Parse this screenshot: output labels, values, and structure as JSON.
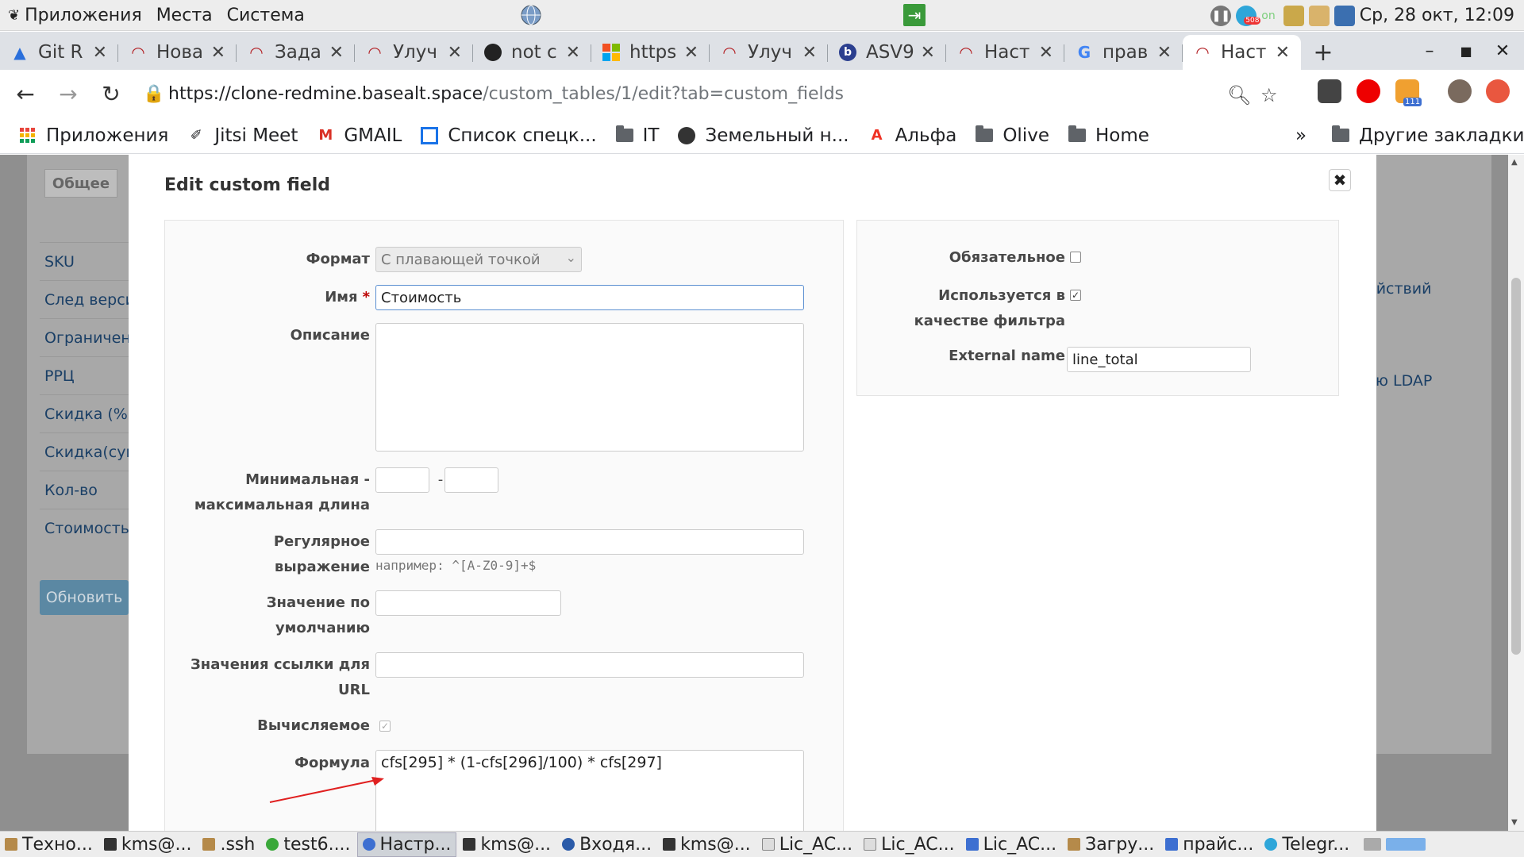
{
  "system_panel": {
    "menu": [
      "Приложения",
      "Места",
      "Система"
    ],
    "clock": "Ср, 28 окт, 12:09",
    "telegram_badge": "508",
    "status_on": "on"
  },
  "tabs": [
    {
      "title": "Git R",
      "icon": "atlassian-icon"
    },
    {
      "title": "Нова",
      "icon": "redmine-icon"
    },
    {
      "title": "Зада",
      "icon": "redmine-icon"
    },
    {
      "title": "Улуч",
      "icon": "redmine-icon"
    },
    {
      "title": "not c",
      "icon": "github-icon"
    },
    {
      "title": "https",
      "icon": "microsoft-icon"
    },
    {
      "title": "Улуч",
      "icon": "redmine-icon"
    },
    {
      "title": "ASV9",
      "icon": "b-icon"
    },
    {
      "title": "Наст",
      "icon": "redmine-icon"
    },
    {
      "title": "прав",
      "icon": "google-icon"
    },
    {
      "title": "Наст",
      "icon": "redmine-icon"
    }
  ],
  "address": {
    "host": "https://clone-redmine.basealt.space",
    "path": "/custom_tables/1/edit?tab=custom_fields",
    "rss_badge": "111"
  },
  "bookmarks": {
    "items": [
      "Приложения",
      "Jitsi Meet",
      "GMAIL",
      "Список спецк...",
      "IT",
      "Земельный н...",
      "Альфа",
      "Olive",
      "Home"
    ],
    "more": "»",
    "other": "Другие закладки"
  },
  "background": {
    "tab": "Общее",
    "list": [
      "SKU",
      "След верси",
      "Ограничени",
      "РРЦ",
      "Скидка (%)",
      "Скидка(сум",
      "Кол-во",
      "Стоимость"
    ],
    "update_button": "Обновить",
    "right_1": "ействий",
    "right_2": "ю LDAP"
  },
  "modal": {
    "title": "Edit custom field",
    "close": "✖",
    "labels": {
      "format": "Формат",
      "name": "Имя",
      "required_mark": "*",
      "description": "Описание",
      "minmax_1": "Минимальная -",
      "minmax_2": "максимальная длина",
      "minmax_sep": "-",
      "regex_1": "Регулярное",
      "regex_2": "выражение",
      "default_1": "Значение по",
      "default_2": "умолчанию",
      "url_1": "Значения ссылки для",
      "url_2": "URL",
      "computed": "Вычисляемое",
      "formula": "Формула",
      "is_required": "Обязательное",
      "filter_1": "Используется в",
      "filter_2": "качестве фильтра",
      "external_name": "External name"
    },
    "values": {
      "format": "С плавающей точкой",
      "name": "Стоимость",
      "regex_hint": "например: ^[A-Z0-9]+$",
      "formula": "cfs[295] * (1-cfs[296]/100) * cfs[297]",
      "external_name": "line_total",
      "is_required": false,
      "used_as_filter": true,
      "computed": true
    }
  },
  "taskbar": [
    "Техно...",
    "kms@...",
    ".ssh",
    "test6....",
    "Настр...",
    "kms@...",
    "Входя...",
    "kms@...",
    "Lic_AC...",
    "Lic_AC...",
    "Lic_AC...",
    "Загру...",
    "прайс...",
    "Telegr..."
  ],
  "colors": {
    "overlay": "#8f8f8f",
    "link": "#1a3f66",
    "required": "#bb0000",
    "arrow": "#e02020"
  }
}
